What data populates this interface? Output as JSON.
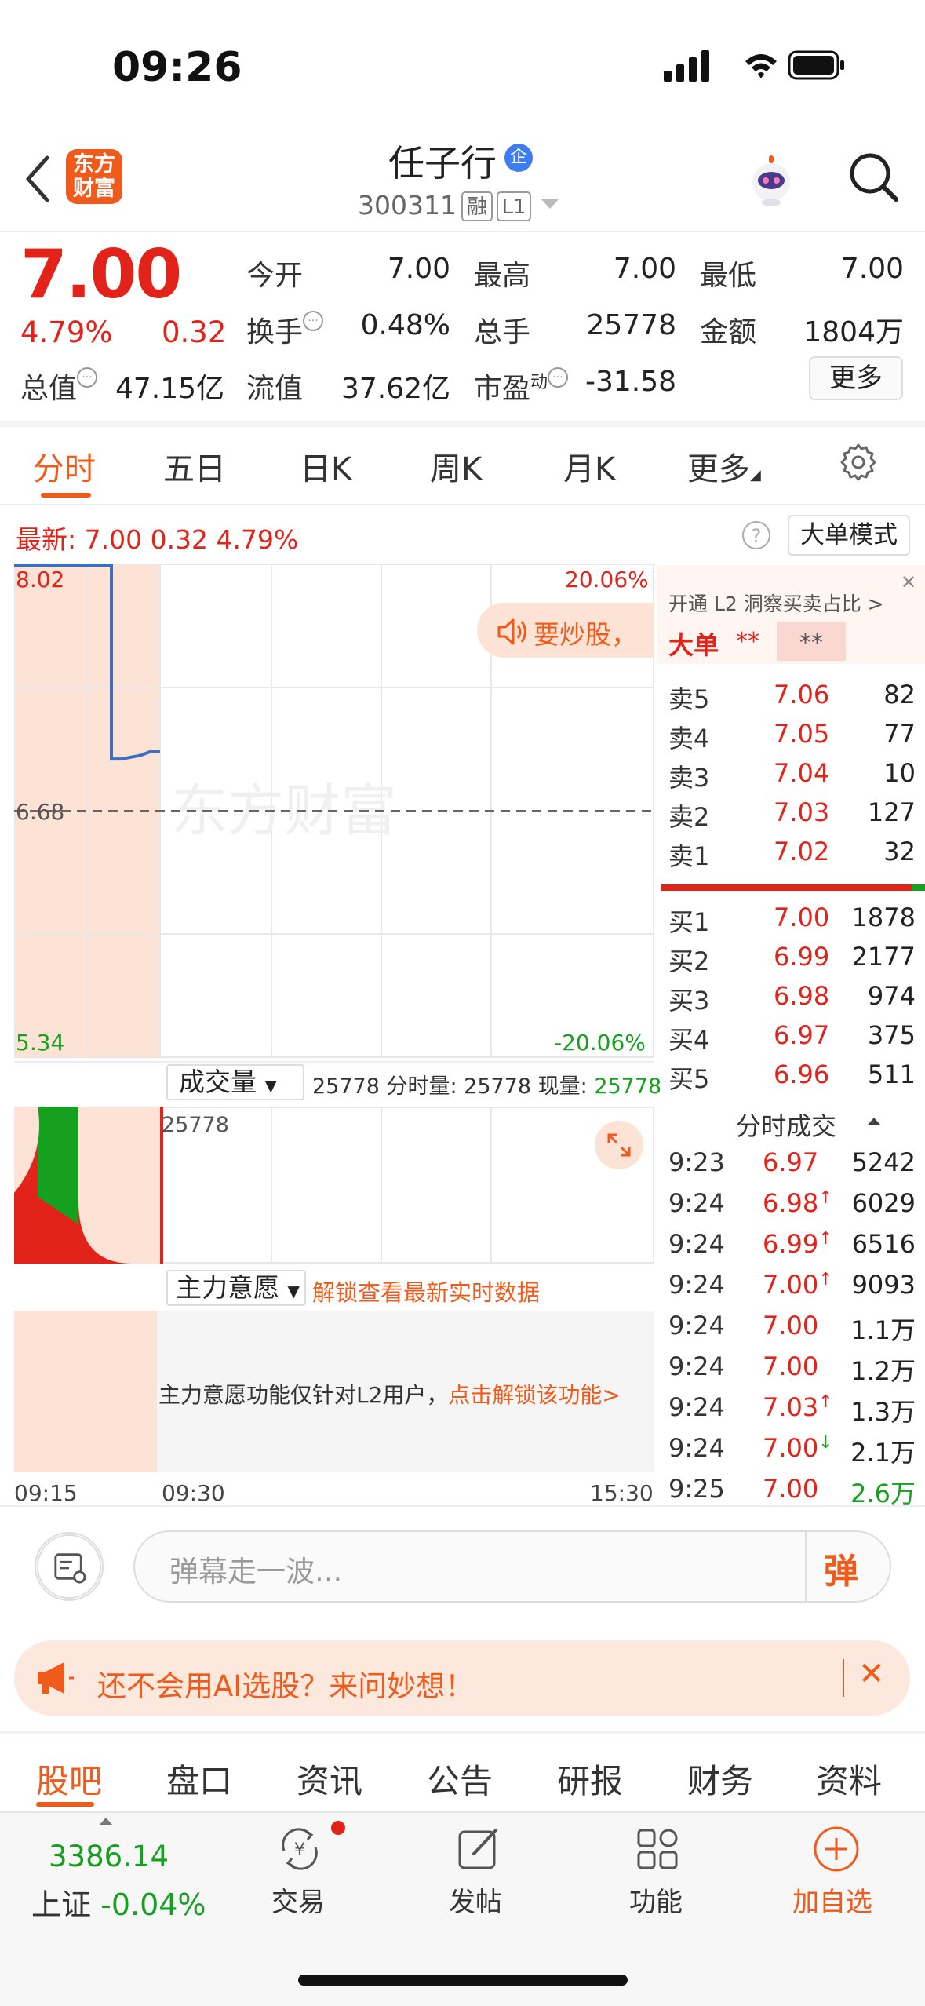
{
  "status_bar": {
    "time": "09:26"
  },
  "header": {
    "logo_line1": "东方",
    "logo_line2": "财富",
    "stock_name": "任子行",
    "verify_badge": "企",
    "stock_code": "300311",
    "tag_margin": "融",
    "tag_level": "L1"
  },
  "quote": {
    "price": "7.00",
    "change_pct": "4.79%",
    "change_amt": "0.32",
    "fields": {
      "open_label": "今开",
      "open": "7.00",
      "high_label": "最高",
      "high": "7.00",
      "low_label": "最低",
      "low": "7.00",
      "turnover_label": "换手",
      "turnover": "0.48%",
      "volume_label": "总手",
      "volume": "25778",
      "amount_label": "金额",
      "amount": "1804万",
      "mktcap_label": "总值",
      "mktcap": "47.15亿",
      "float_label": "流值",
      "float_cap": "37.62亿",
      "pe_label": "市盈",
      "pe_sup": "动",
      "pe": "-31.58"
    },
    "more_label": "更多",
    "info_glyph": "···"
  },
  "chart_tabs": [
    "分时",
    "五日",
    "日K",
    "周K",
    "月K",
    "更多"
  ],
  "latest": {
    "text": "最新: 7.00  0.32  4.79%",
    "help": "?",
    "big_order_mode": "大单模式"
  },
  "price_chart": {
    "y_top": "8.02",
    "y_mid": "6.68",
    "y_bottom": "5.34",
    "pct_top": "20.06%",
    "pct_bottom": "-20.06%",
    "watermark": "东方财富",
    "promo": "要炒股，"
  },
  "chart_data": {
    "type": "line",
    "x": [
      "09:15",
      "09:16",
      "09:17",
      "09:18",
      "09:19",
      "09:20",
      "09:21",
      "09:22",
      "09:23",
      "09:24",
      "09:25",
      "09:26",
      "09:27",
      "09:28",
      "09:29",
      "09:30"
    ],
    "series": [
      {
        "values": [
          8.02,
          8.02,
          8.02,
          8.02,
          8.02,
          8.02,
          8.02,
          8.02,
          8.02,
          8.02,
          8.02,
          6.96,
          6.97,
          6.98,
          7.0,
          7.0
        ]
      }
    ],
    "ylim": [
      5.34,
      8.02
    ],
    "reference": 6.68,
    "x_ticks": [
      "09:15",
      "09:30",
      "15:30"
    ]
  },
  "volume": {
    "selector": "成交量",
    "info_prefix": "25778 分时量: 25778 现量: ",
    "info_value": "25778",
    "axis_max": "25778"
  },
  "main_force": {
    "selector": "主力意愿",
    "unlock": "解锁查看最新实时数据",
    "note": "主力意愿功能仅针对L2用户，",
    "note_link": "点击解锁该功能>"
  },
  "time_axis": {
    "start": "09:15",
    "mid": "09:30",
    "end": "15:30"
  },
  "order_book": {
    "l2_text": "开通 L2 洞察买卖占比 >",
    "close": "✕",
    "big_order": "大单",
    "stars1": "**",
    "stars2": "**",
    "asks": [
      {
        "label": "卖5",
        "price": "7.06",
        "vol": "82"
      },
      {
        "label": "卖4",
        "price": "7.05",
        "vol": "77"
      },
      {
        "label": "卖3",
        "price": "7.04",
        "vol": "10"
      },
      {
        "label": "卖2",
        "price": "7.03",
        "vol": "127"
      },
      {
        "label": "卖1",
        "price": "7.02",
        "vol": "32"
      }
    ],
    "bids": [
      {
        "label": "买1",
        "price": "7.00",
        "vol": "1878"
      },
      {
        "label": "买2",
        "price": "6.99",
        "vol": "2177"
      },
      {
        "label": "买3",
        "price": "6.98",
        "vol": "974"
      },
      {
        "label": "买4",
        "price": "6.97",
        "vol": "375"
      },
      {
        "label": "买5",
        "price": "6.96",
        "vol": "511"
      }
    ]
  },
  "trades": {
    "title": "分时成交",
    "rows": [
      {
        "time": "9:23",
        "price": "6.97",
        "arrow": "",
        "vol": "5242",
        "vol_color": "#222"
      },
      {
        "time": "9:24",
        "price": "6.98",
        "arrow": "↑",
        "vol": "6029",
        "vol_color": "#222"
      },
      {
        "time": "9:24",
        "price": "6.99",
        "arrow": "↑",
        "vol": "6516",
        "vol_color": "#222"
      },
      {
        "time": "9:24",
        "price": "7.00",
        "arrow": "↑",
        "vol": "9093",
        "vol_color": "#222"
      },
      {
        "time": "9:24",
        "price": "7.00",
        "arrow": "",
        "vol": "1.1万",
        "vol_color": "#222"
      },
      {
        "time": "9:24",
        "price": "7.00",
        "arrow": "",
        "vol": "1.2万",
        "vol_color": "#222"
      },
      {
        "time": "9:24",
        "price": "7.03",
        "arrow": "↑",
        "vol": "1.3万",
        "vol_color": "#222"
      },
      {
        "time": "9:24",
        "price": "7.00",
        "arrow": "↓",
        "vol": "2.1万",
        "vol_color": "#222"
      },
      {
        "time": "9:25",
        "price": "7.00",
        "arrow": "",
        "vol": "2.6万",
        "vol_color": "#16a01f"
      }
    ]
  },
  "danmaku": {
    "placeholder": "弹幕走一波...",
    "send": "弹"
  },
  "ai_banner": {
    "text": "还不会用AI选股？来问妙想！",
    "close": "✕"
  },
  "bottom_tabs": [
    "股吧",
    "盘口",
    "资讯",
    "公告",
    "研报",
    "财务",
    "资料"
  ],
  "nav": {
    "index_value": "3386.14",
    "index_name": "上证",
    "index_change": "-0.04%",
    "trade": "交易",
    "post": "发帖",
    "function": "功能",
    "add_watch": "加自选",
    "add_icon": "+"
  },
  "colors": {
    "up": "#e2231a",
    "down": "#16a01f",
    "accent": "#f05a1a",
    "line": "#3a6fc4"
  },
  "icons": [
    "back-icon",
    "search-icon",
    "robot-avatar",
    "settings-icon",
    "speaker-icon",
    "expand-icon",
    "danmaku-settings-icon",
    "horn-icon",
    "trade-icon",
    "post-icon",
    "function-icon",
    "add-icon"
  ]
}
